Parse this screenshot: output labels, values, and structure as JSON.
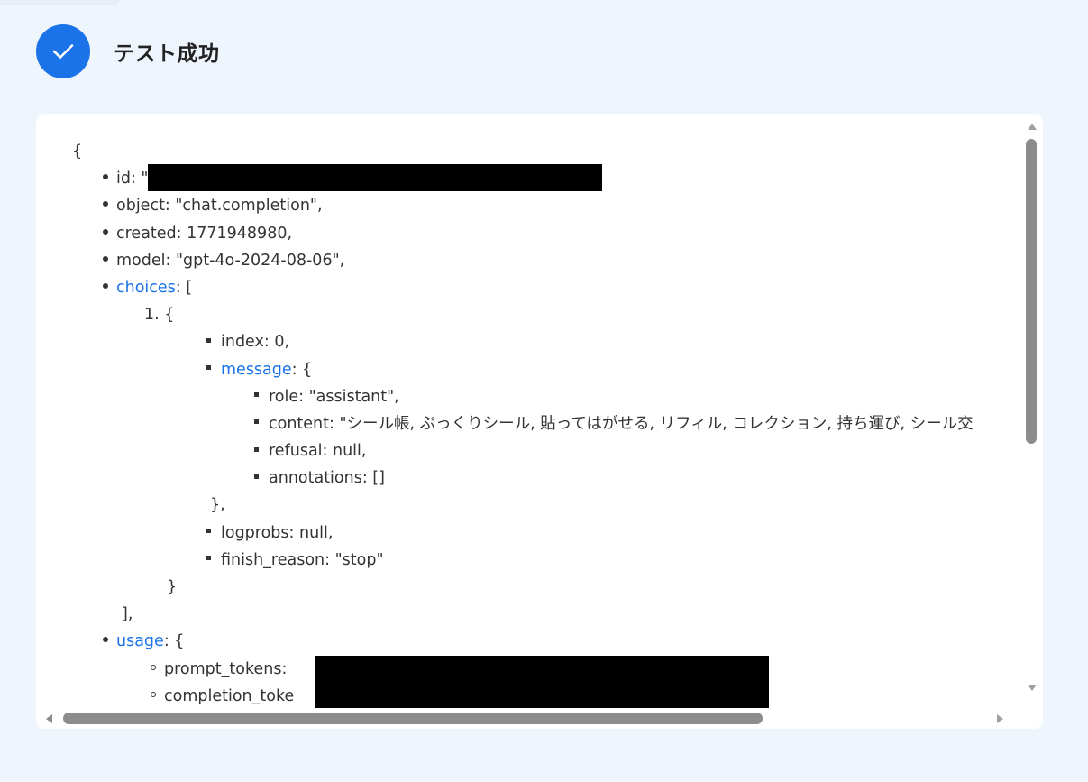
{
  "header": {
    "title": "テスト成功",
    "icon": "check-icon",
    "accent_color": "#1a73e8"
  },
  "json_view": {
    "open_brace": "{",
    "id_label": "id: \"",
    "object_line": "object: \"chat.completion\",",
    "created_line": "created: 1771948980,",
    "model_line": "model: \"gpt-4o-2024-08-06\",",
    "choices_key": "choices",
    "choices_open": ": [",
    "item_number": "1. {",
    "index_line": "index: 0,",
    "message_key": "message",
    "message_open": ": {",
    "role_line": "role: \"assistant\",",
    "content_line": "content: \"シール帳, ぷっくりシール, 貼ってはがせる, リフィル, コレクション, 持ち運び, シール交",
    "refusal_line": "refusal: null,",
    "annotations_line": "annotations: []",
    "message_close": "},",
    "logprobs_line": "logprobs: null,",
    "finish_reason_line": "finish_reason: \"stop\"",
    "item_close": "}",
    "choices_close": "],",
    "usage_key": "usage",
    "usage_open": ": {",
    "prompt_tokens_label": "prompt_tokens: ",
    "completion_tokens_label": "completion_toke"
  },
  "link_color": "#1a73e8",
  "redaction_color": "#000000"
}
